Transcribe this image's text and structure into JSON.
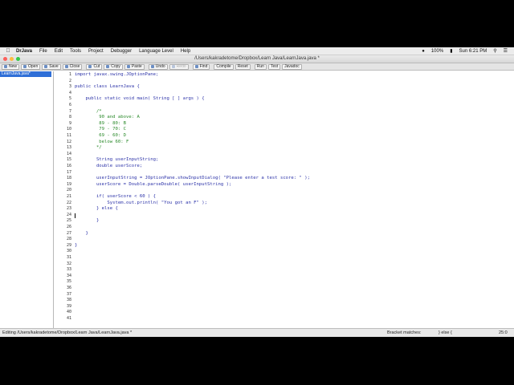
{
  "menubar": {
    "app_name": "DrJava",
    "items": [
      "File",
      "Edit",
      "Tools",
      "Project",
      "Debugger",
      "Language Level",
      "Help"
    ],
    "battery": "100%",
    "clock": "Sun 6:21 PM"
  },
  "window": {
    "title": "/Users/kakradetome/Dropbox/Learn Java/LearnJava.java *"
  },
  "toolbar": {
    "buttons": [
      {
        "label": "New",
        "enabled": true
      },
      {
        "label": "Open",
        "enabled": true
      },
      {
        "label": "Save",
        "enabled": true
      },
      {
        "label": "Close",
        "enabled": true
      },
      {
        "label": "Cut",
        "enabled": true
      },
      {
        "label": "Copy",
        "enabled": true
      },
      {
        "label": "Paste",
        "enabled": true
      },
      {
        "label": "Undo",
        "enabled": true
      },
      {
        "label": "Redo",
        "enabled": false
      },
      {
        "label": "Find",
        "enabled": true
      },
      {
        "label": "Compile",
        "enabled": true
      },
      {
        "label": "Reset",
        "enabled": true
      },
      {
        "label": "Run",
        "enabled": true
      },
      {
        "label": "Test",
        "enabled": true
      },
      {
        "label": "Javadoc",
        "enabled": true
      }
    ]
  },
  "files": {
    "open_files": [
      "LearnJava.java*"
    ]
  },
  "editor": {
    "lines": [
      {
        "n": "1",
        "text": "import javax.swing.JOptionPane;",
        "style": "kw"
      },
      {
        "n": "2",
        "text": "",
        "style": "kw"
      },
      {
        "n": "3",
        "text": "public class LearnJava {",
        "style": "kw"
      },
      {
        "n": "4",
        "text": "",
        "style": "kw"
      },
      {
        "n": "5",
        "text": "    public static void main( String [ ] args ) {",
        "style": "kw"
      },
      {
        "n": "6",
        "text": "",
        "style": "kw"
      },
      {
        "n": "7",
        "text": "        /*",
        "style": "cm"
      },
      {
        "n": "8",
        "text": "         90 and above: A",
        "style": "cm"
      },
      {
        "n": "9",
        "text": "         89 - 80: B",
        "style": "cm"
      },
      {
        "n": "10",
        "text": "         79 - 70: C",
        "style": "cm"
      },
      {
        "n": "11",
        "text": "         69 - 60: D",
        "style": "cm"
      },
      {
        "n": "12",
        "text": "         below 60: F",
        "style": "cm"
      },
      {
        "n": "13",
        "text": "        */",
        "style": "cm"
      },
      {
        "n": "14",
        "text": "",
        "style": "kw"
      },
      {
        "n": "15",
        "text": "        String userInputString;",
        "style": "kw"
      },
      {
        "n": "16",
        "text": "        double userScore;",
        "style": "kw"
      },
      {
        "n": "17",
        "text": "",
        "style": "kw"
      },
      {
        "n": "18",
        "text": "        userInputString = JOptionPane.showInputDialog( \"Please enter a test score: \" );",
        "style": "kw"
      },
      {
        "n": "19",
        "text": "        userScore = Double.parseDouble( userInputString );",
        "style": "kw"
      },
      {
        "n": "20",
        "text": "",
        "style": "kw"
      },
      {
        "n": "21",
        "text": "        if( userScore < 60 ) {",
        "style": "kw"
      },
      {
        "n": "22",
        "text": "            System.out.println( \"You got an F\" );",
        "style": "kw"
      },
      {
        "n": "23",
        "text": "        } else {",
        "style": "kw"
      },
      {
        "n": "24",
        "text": "",
        "style": "kw"
      },
      {
        "n": "25",
        "text": "        }",
        "style": "kw"
      },
      {
        "n": "26",
        "text": "",
        "style": "kw"
      },
      {
        "n": "27",
        "text": "    }",
        "style": "kw"
      },
      {
        "n": "28",
        "text": "",
        "style": "kw"
      },
      {
        "n": "29",
        "text": "}",
        "style": "kw"
      },
      {
        "n": "30",
        "text": "",
        "style": "kw"
      },
      {
        "n": "31",
        "text": "",
        "style": "kw"
      },
      {
        "n": "32",
        "text": "",
        "style": "kw"
      },
      {
        "n": "33",
        "text": "",
        "style": "kw"
      },
      {
        "n": "34",
        "text": "",
        "style": "kw"
      },
      {
        "n": "35",
        "text": "",
        "style": "kw"
      },
      {
        "n": "36",
        "text": "",
        "style": "kw"
      },
      {
        "n": "37",
        "text": "",
        "style": "kw"
      },
      {
        "n": "38",
        "text": "",
        "style": "kw"
      },
      {
        "n": "39",
        "text": "",
        "style": "kw"
      },
      {
        "n": "40",
        "text": "",
        "style": "kw"
      },
      {
        "n": "41",
        "text": "",
        "style": "kw"
      }
    ],
    "caret_line": 24
  },
  "status": {
    "editing": "Editing /Users/kakradetome/Dropbox/Learn Java/LearnJava.java *",
    "bracket_label": "Bracket matches:",
    "bracket_value": "} else {",
    "position": "25:0"
  },
  "colors": {
    "keyword": "#2b32a8",
    "comment": "#2b8a2b",
    "selection": "#2f6fd7"
  }
}
